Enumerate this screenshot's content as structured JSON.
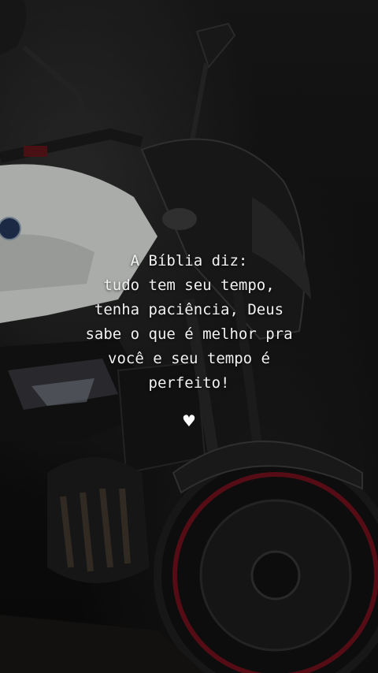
{
  "quote": {
    "lines": [
      "A Bíblia diz:",
      "tudo tem seu tempo,",
      "tenha paciência, Deus",
      "sabe o que é melhor pra",
      "você e seu tempo é",
      "perfeito!"
    ]
  },
  "heart": "♥",
  "colors": {
    "text": "#f2f2f2",
    "bike_body": "#d9dcd9",
    "wheel_accent": "#8a1020",
    "background": "#111111"
  }
}
